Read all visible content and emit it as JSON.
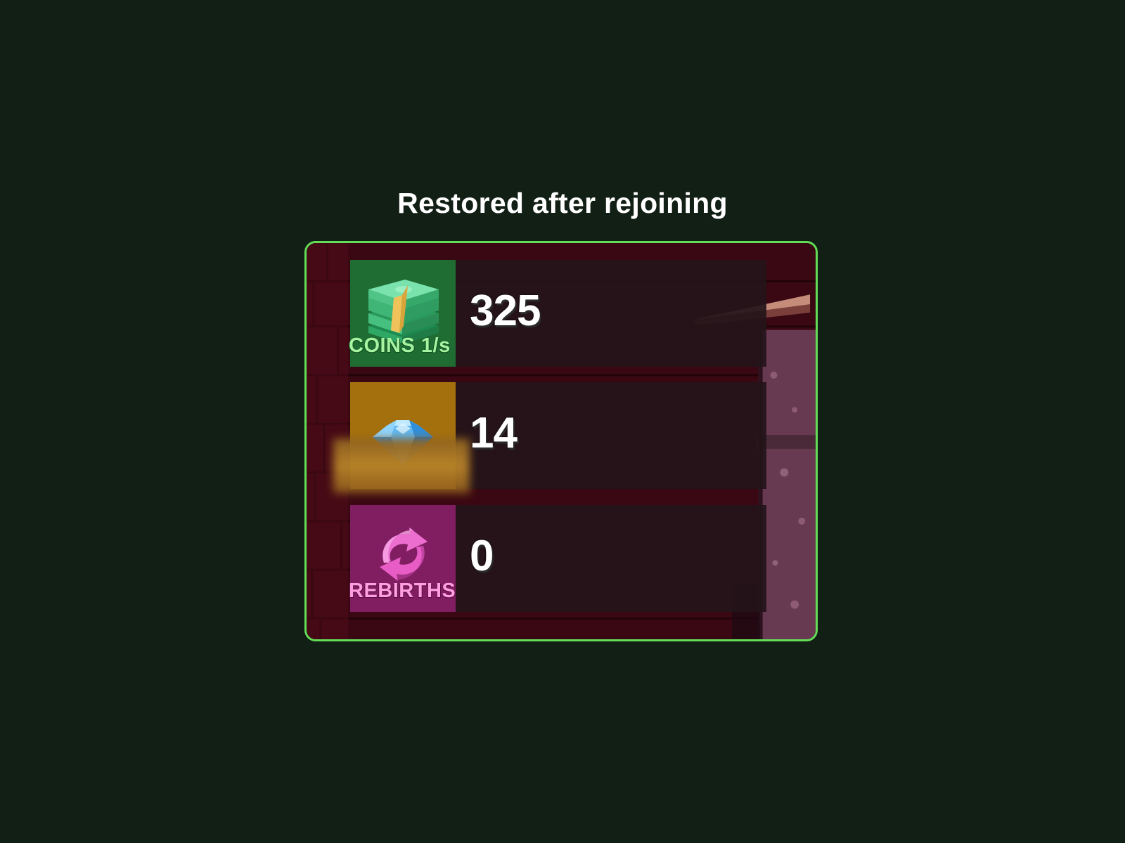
{
  "caption": "Restored after rejoining",
  "colors": {
    "frame_border": "#63df57",
    "coins_tile": "#1f6d33",
    "gems_tile": "#a4700e",
    "rebirths_tile": "#801e61"
  },
  "hud": {
    "coins": {
      "icon": "cash-stack-icon",
      "label": "COINS 1/s",
      "value": "325"
    },
    "gems": {
      "icon": "diamond-icon",
      "label_obscured": true,
      "value": "14"
    },
    "rebirths": {
      "icon": "rebirth-arrows-icon",
      "label": "REBIRTHS",
      "value": "0"
    }
  }
}
